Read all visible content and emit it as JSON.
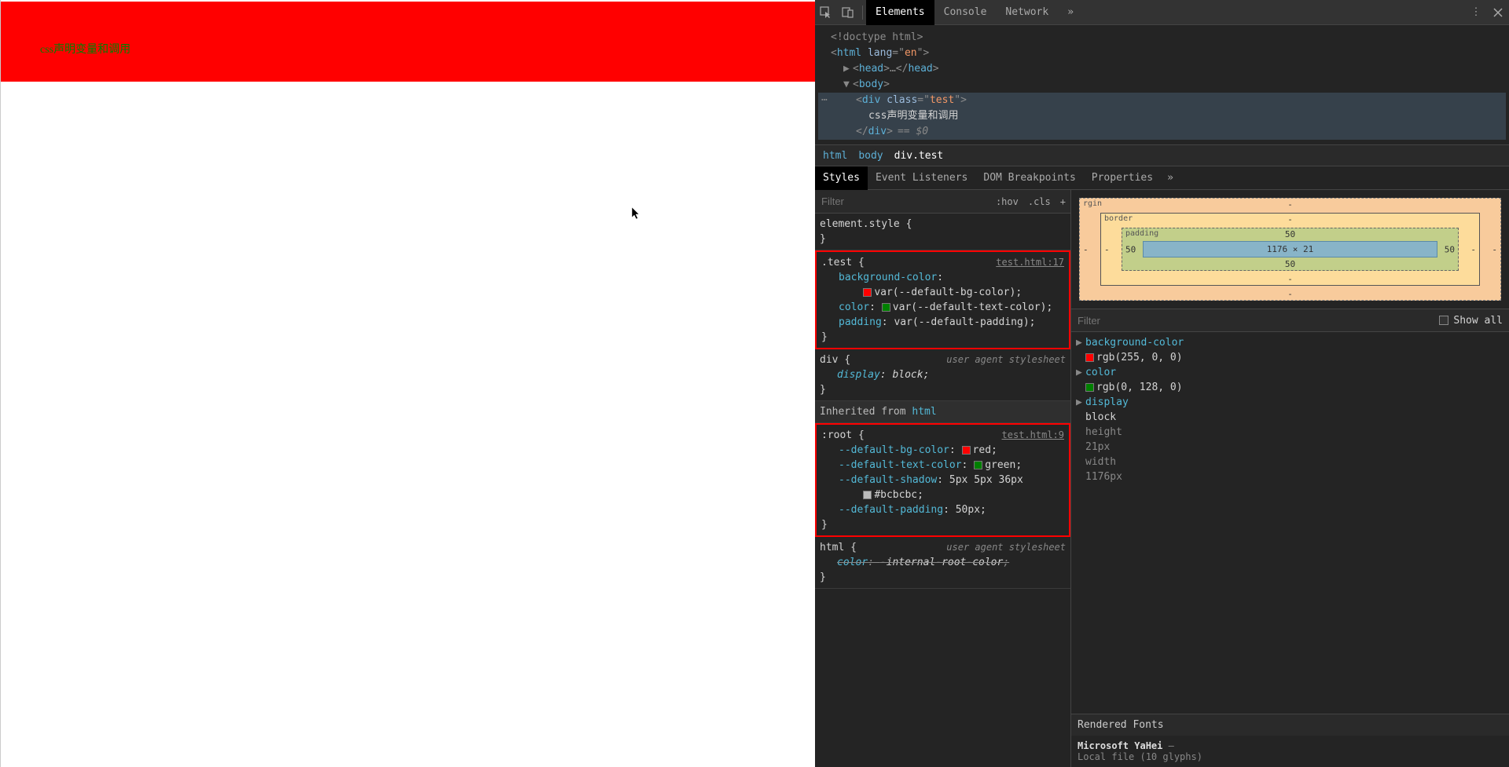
{
  "viewport": {
    "test_text": "css声明变量和调用"
  },
  "tabs": {
    "elements": "Elements",
    "console": "Console",
    "network": "Network"
  },
  "dom": {
    "doctype": "<!doctype html>",
    "html_open": "html",
    "html_lang_attr": "lang",
    "html_lang_val": "en",
    "head": "head",
    "body": "body",
    "div_tag": "div",
    "div_class_attr": "class",
    "div_class_val": "test",
    "div_text": "css声明变量和调用",
    "eq": "== $0"
  },
  "crumbs": {
    "c1": "html",
    "c2": "body",
    "c3": "div.test"
  },
  "sub_tabs": {
    "styles": "Styles",
    "listeners": "Event Listeners",
    "dom_bp": "DOM Breakpoints",
    "props": "Properties"
  },
  "filter": {
    "placeholder": "Filter",
    "hov": ":hov",
    "cls": ".cls"
  },
  "rules": {
    "element_style": "element.style",
    "test_selector": ".test",
    "test_source": "test.html:17",
    "test_bg_prop": "background-color",
    "test_bg_val": "var(--default-bg-color)",
    "test_color_prop": "color",
    "test_color_val": "var(--default-text-color)",
    "test_pad_prop": "padding",
    "test_pad_val": "var(--default-padding)",
    "div_selector": "div",
    "ua_label": "user agent stylesheet",
    "div_display_prop": "display",
    "div_display_val": "block",
    "inherited": "Inherited from",
    "inherited_from": "html",
    "root_selector": ":root",
    "root_source": "test.html:9",
    "root_bg_prop": "--default-bg-color",
    "root_bg_val": "red",
    "root_txt_prop": "--default-text-color",
    "root_txt_val": "green",
    "root_shadow_prop": "--default-shadow",
    "root_shadow_val_pre": "5px 5px 36px",
    "root_shadow_val_color": "#bcbcbc",
    "root_pad_prop": "--default-padding",
    "root_pad_val": "50px",
    "html_selector": "html",
    "html_color_prop": "color",
    "html_color_val": "-internal-root-color"
  },
  "box": {
    "margin_label": "rgin",
    "border_label": "border",
    "padding_label": "padding",
    "pad_t": "50",
    "pad_b": "50",
    "pad_l": "50",
    "pad_r": "50",
    "dims": "1176 × 21",
    "dash": "-"
  },
  "comp_filter": {
    "placeholder": "Filter",
    "showall": "Show all"
  },
  "computed": {
    "bg_prop": "background-color",
    "bg_val": "rgb(255, 0, 0)",
    "color_prop": "color",
    "color_val": "rgb(0, 128, 0)",
    "display_prop": "display",
    "display_val": "block",
    "height_prop": "height",
    "height_val": "21px",
    "width_prop": "width",
    "width_val": "1176px"
  },
  "rendered": {
    "hdr": "Rendered Fonts",
    "font": "Microsoft YaHei",
    "dash": "—",
    "detail": "Local file (10 glyphs)"
  },
  "colors": {
    "red": "#ff0000",
    "green": "#008000",
    "grey": "#bcbcbc"
  }
}
